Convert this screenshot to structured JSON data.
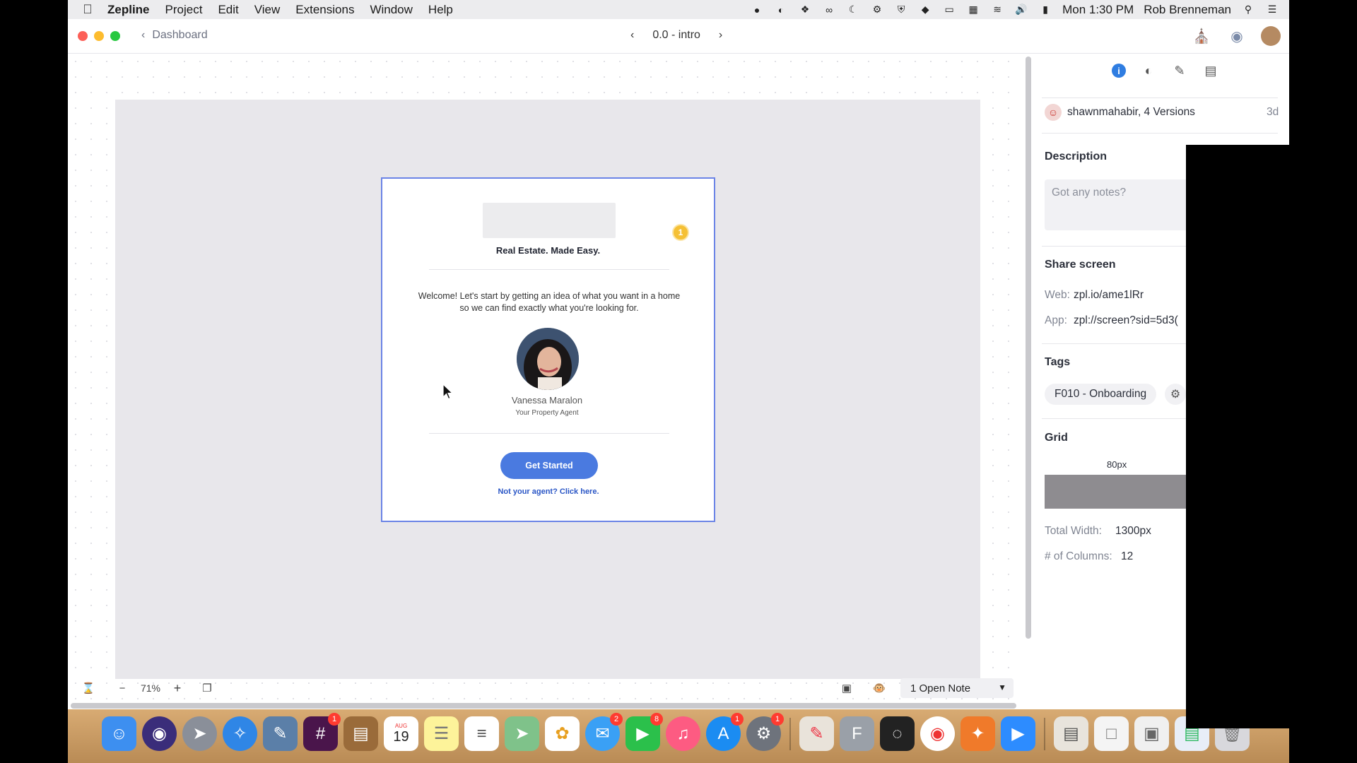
{
  "menubar": {
    "app_name": "Zepline",
    "menus": [
      "Project",
      "Edit",
      "View",
      "Extensions",
      "Window",
      "Help"
    ],
    "clock": "Mon 1:30 PM",
    "user": "Rob Brenneman"
  },
  "titlebar": {
    "back_label": "Dashboard",
    "screen_name": "0.0 - intro"
  },
  "artboard": {
    "tagline": "Real Estate. Made Easy.",
    "badge": "1",
    "welcome": "Welcome! Let's start by getting an idea of what you want in a home so we can find exactly what you're looking for.",
    "agent_name": "Vanessa Maralon",
    "agent_role": "Your Property Agent",
    "cta": "Get Started",
    "link": "Not your agent? Click here."
  },
  "bottombar": {
    "zoom": "71%",
    "notes_select": "1 Open Note"
  },
  "sidebar": {
    "author_versions": "shawnmahabir, 4 Versions",
    "age": "3d",
    "description_label": "Description",
    "notes_placeholder": "Got any notes?",
    "share_label": "Share screen",
    "web_label": "Web:",
    "web_value": "zpl.io/ame1lRr",
    "app_label": "App:",
    "app_value": "zpl://screen?sid=5d3(",
    "tags_label": "Tags",
    "tag": "F010 - Onboarding",
    "grid_label": "Grid",
    "grid_width_label": "80px",
    "total_width_label": "Total Width:",
    "total_width_value": "1300px",
    "columns_label": "# of Columns:",
    "columns_value": "12"
  },
  "dock": {
    "badges": {
      "slack": "1",
      "messages": "2",
      "facetime": "8",
      "appstore": "1",
      "settings": "1"
    },
    "calendar_day": "19",
    "calendar_month": "AUG"
  }
}
